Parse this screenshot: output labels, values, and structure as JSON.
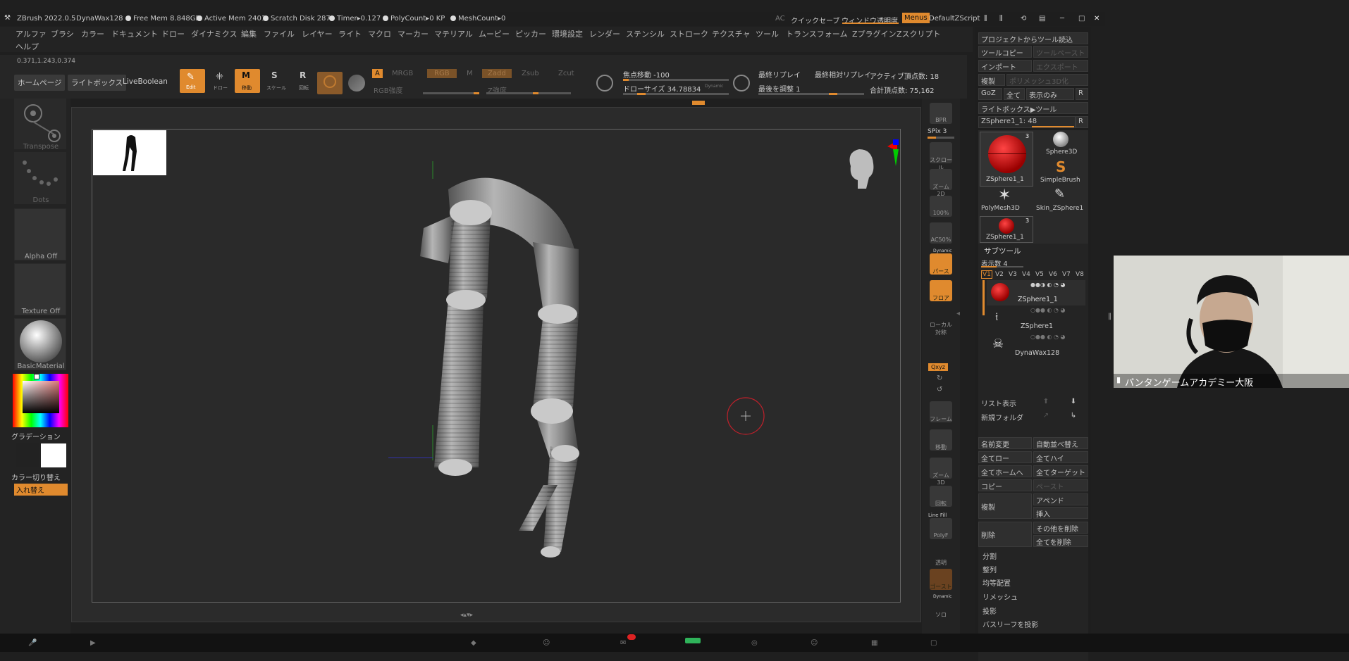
{
  "titlebar": {
    "app": "ZBrush 2022.0.5",
    "doc": "DynaWax128",
    "stats": [
      "Free Mem 8.848GB",
      "Active Mem 2401",
      "Scratch Disk 287",
      "Timer▸0.127",
      "PolyCount▸0 KP",
      "MeshCount▸0"
    ],
    "ac": "AC",
    "quicksave": "クイックセーブ",
    "transparency": "ウィンドウ透明度",
    "menus": "Menus",
    "script": "DefaultZScript"
  },
  "menubar": {
    "items": [
      "アルファ",
      "ブラシ",
      "カラー",
      "ドキュメント",
      "ドロー",
      "ダイナミクス",
      "編集",
      "ファイル",
      "レイヤー",
      "ライト",
      "マクロ",
      "マーカー",
      "マテリアル",
      "ムービー",
      "ピッカー",
      "環境設定",
      "レンダー",
      "ステンシル",
      "ストローク",
      "テクスチャ",
      "ツール",
      "トランスフォーム",
      "Zプラグイン",
      "Zスクリプト"
    ],
    "help": "ヘルプ"
  },
  "coords": "0.371,1.243,0.374",
  "toolbar": {
    "home": "ホームページ",
    "lightbox": "ライトボックス",
    "liveboolean": "LiveBoolean",
    "edit": "Edit",
    "draw": "ドロー",
    "move": "移動",
    "scale": "スケール",
    "rotate": "回転",
    "a": "A",
    "mrgb": "MRGB",
    "rgb": "RGB",
    "m": "M",
    "zadd": "Zadd",
    "zsub": "Zsub",
    "zcut": "Zcut",
    "rgb_strength": "RGB強度",
    "z_strength": "Z強度",
    "focal_shift": "焦点移動 -100",
    "draw_size": "ドローサイズ 34.78834",
    "dynamic": "Dynamic",
    "last_replay": "最終リプレイ",
    "last_rel_replay": "最終相対リプレイ",
    "adjust_last": "最後を調整 1",
    "active_points": "アクティブ頂点数: 18",
    "total_points": "合計頂点数: 75,162"
  },
  "leftshelf": {
    "transpose": "Transpose",
    "dots": "Dots",
    "alpha": "Alpha Off",
    "texture": "Texture Off",
    "material": "BasicMaterial",
    "gradation": "グラデーション",
    "color_switch": "カラー切り替え",
    "swap": "入れ替え"
  },
  "rightshelf": {
    "bpr": "BPR",
    "spix": "SPix 3",
    "scroll": "スクロール",
    "zoom2d": "ズーム2D",
    "p100": "100%",
    "ac50": "AC50%",
    "dynamic": "Dynamic",
    "perspective": "パース",
    "floor": "フロア",
    "local_sym": "ローカル対称",
    "xyz": "Qxyz",
    "frame": "フレーム",
    "move": "移動",
    "zoom3d": "ズーム3D",
    "rotate": "回転",
    "linefill": "Line Fill",
    "polyf": "PolyF",
    "transp": "透明",
    "ghost": "ゴースト",
    "solo": "ソロ"
  },
  "panel": {
    "import_project": "プロジェクトからツール読込",
    "tool_copy": "ツールコピー",
    "tool_paste": "ツールペースト",
    "import": "インポート",
    "export": "エクスポート",
    "clone": "複製",
    "polymesh3d": "ポリメッシュ3D化",
    "goz": "GoZ",
    "all": "全て",
    "visible_only": "表示のみ",
    "r": "R",
    "lightbox_tool": "ライトボックス▶ツール",
    "current_tool": "ZSphere1_1: 48",
    "tools": [
      {
        "name": "ZSphere1_1",
        "badge": "3"
      },
      {
        "name": "Sphere3D",
        "badge": ""
      },
      {
        "name": "SimpleBrush",
        "badge": ""
      },
      {
        "name": "PolyMesh3D",
        "badge": ""
      },
      {
        "name": "Skin_ZSphere1",
        "badge": ""
      },
      {
        "name": "ZSphere1_1",
        "badge": "3"
      }
    ],
    "subtool_title": "サブツール",
    "display_count": "表示数 4",
    "versions": [
      "V1",
      "V2",
      "V3",
      "V4",
      "V5",
      "V6",
      "V7",
      "V8"
    ],
    "subtools": [
      "ZSphere1_1",
      "ZSphere1",
      "DynaWax128"
    ],
    "list_all": "リスト表示",
    "new_folder": "新規フォルダ",
    "rename": "名前変更",
    "auto_reorder": "自動並べ替え",
    "all_low": "全てロー",
    "all_high": "全てハイ",
    "all_home": "全てホームへ",
    "all_target": "全てターゲット",
    "copy": "コピー",
    "paste": "ペースト",
    "duplicate": "複製",
    "append": "アペンド",
    "insert": "挿入",
    "delete": "削除",
    "delete_others": "その他を削除",
    "delete_all": "全てを削除",
    "split": "分割",
    "merge": "整列",
    "equal_layout": "均等配置",
    "remesh": "リメッシュ",
    "project": "投影",
    "project_basrelief": "バスリーフを投影"
  },
  "webcam": {
    "caption": "パンタンゲームアカデミー大阪"
  },
  "colors": {
    "accent": "#e08a2e",
    "bg": "#1f1f1f",
    "panel": "#1e1e1e"
  }
}
